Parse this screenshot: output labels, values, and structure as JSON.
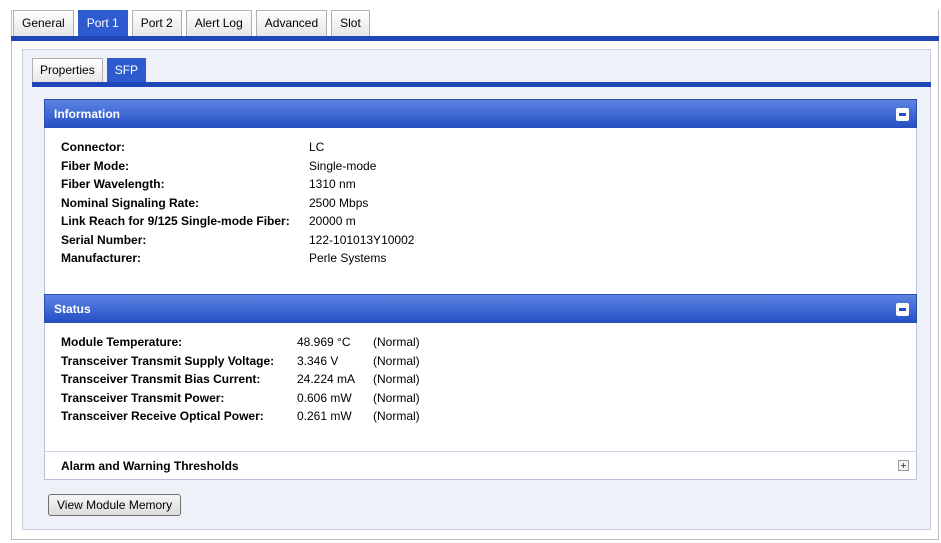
{
  "top_tabs": [
    "General",
    "Port 1",
    "Port 2",
    "Alert Log",
    "Advanced",
    "Slot"
  ],
  "inner_tabs": [
    "Properties",
    "SFP"
  ],
  "information": {
    "title": "Information",
    "rows": [
      {
        "label": "Connector:",
        "value": "LC"
      },
      {
        "label": "Fiber Mode:",
        "value": "Single-mode"
      },
      {
        "label": "Fiber Wavelength:",
        "value": "1310 nm"
      },
      {
        "label": "Nominal Signaling Rate:",
        "value": "2500 Mbps"
      },
      {
        "label": "Link Reach for 9/125 Single-mode Fiber:",
        "value": "20000 m"
      },
      {
        "label": "Serial Number:",
        "value": "122-101013Y10002"
      },
      {
        "label": "Manufacturer:",
        "value": "Perle Systems"
      }
    ]
  },
  "status": {
    "title": "Status",
    "rows": [
      {
        "label": "Module Temperature:",
        "value": "48.969 °C",
        "state": "(Normal)"
      },
      {
        "label": "Transceiver Transmit Supply Voltage:",
        "value": "3.346 V",
        "state": "(Normal)"
      },
      {
        "label": "Transceiver Transmit Bias Current:",
        "value": "24.224 mA",
        "state": "(Normal)"
      },
      {
        "label": "Transceiver Transmit Power:",
        "value": "0.606 mW",
        "state": "(Normal)"
      },
      {
        "label": "Transceiver Receive Optical Power:",
        "value": "0.261 mW",
        "state": "(Normal)"
      }
    ]
  },
  "alarm": {
    "title": "Alarm and Warning Thresholds"
  },
  "view_button": "View Module Memory",
  "colors": {
    "accent": "#2550c5",
    "tab_active": "#2f5bd0",
    "bar": "#1f47b7"
  }
}
